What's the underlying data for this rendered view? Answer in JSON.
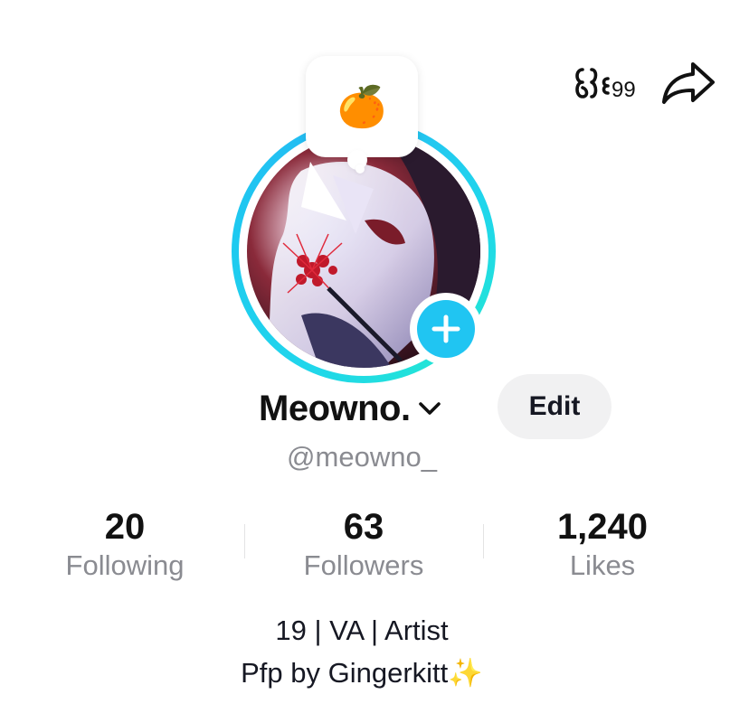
{
  "header": {
    "creator_tools_icon": "creator-tools-icon",
    "share_icon": "share-arrow-icon"
  },
  "note": {
    "emoji": "🍊"
  },
  "profile": {
    "display_name": "Meowno.",
    "edit_label": "Edit",
    "username": "@meowno_",
    "avatar_ring_color": "#20d5ec",
    "add_badge_color": "#20c5f2"
  },
  "stats": [
    {
      "value": "20",
      "label": "Following"
    },
    {
      "value": "63",
      "label": "Followers"
    },
    {
      "value": "1,240",
      "label": "Likes"
    }
  ],
  "bio": {
    "line1": "19 | VA | Artist",
    "line2": "Pfp by Gingerkitt",
    "line2_emoji": "✨"
  }
}
